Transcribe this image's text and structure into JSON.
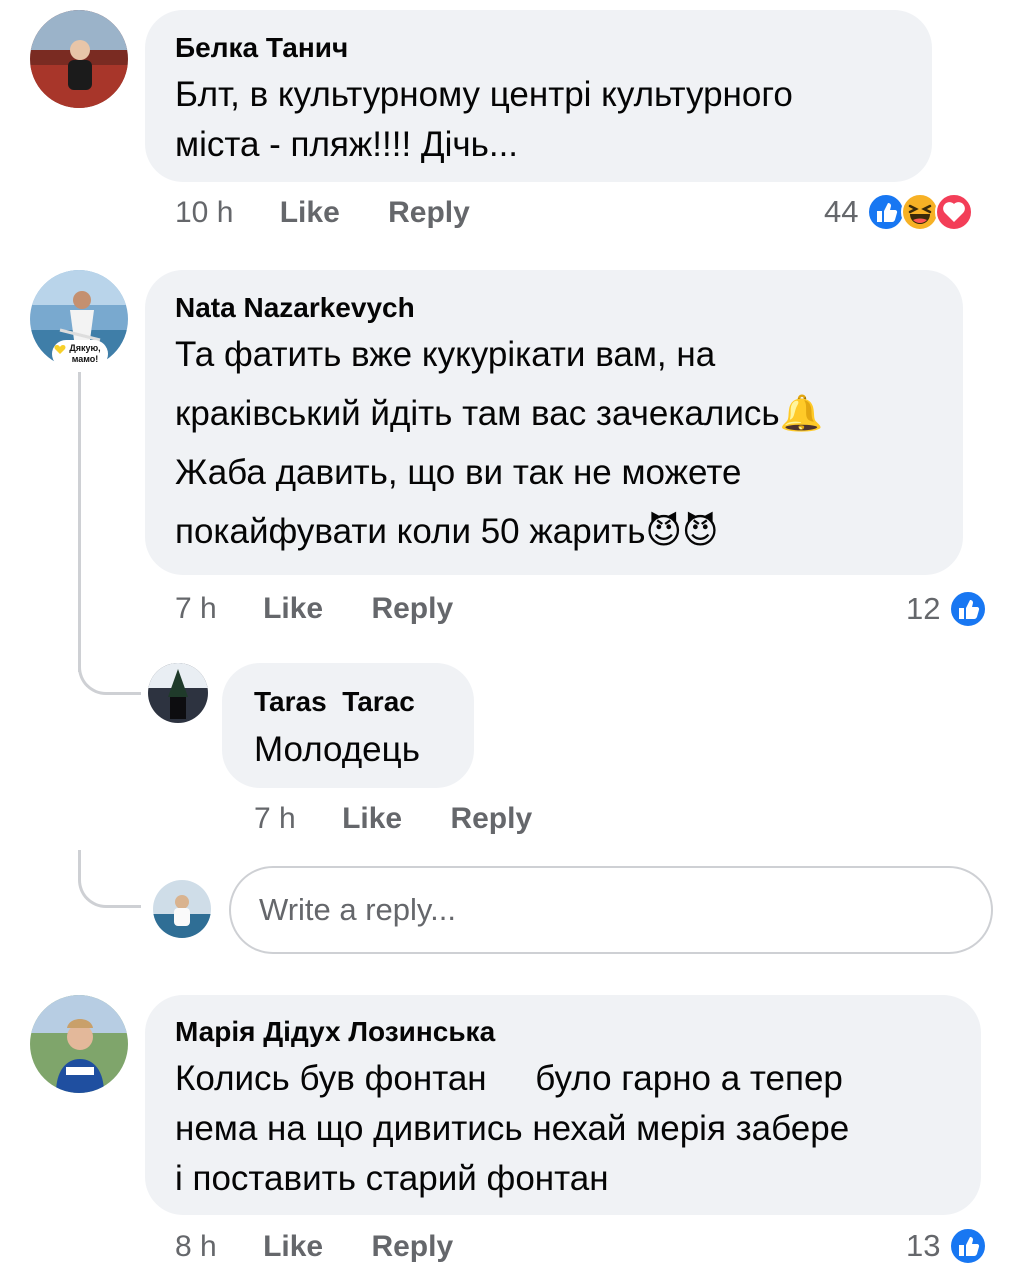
{
  "comments": [
    {
      "author": "Белка Танич",
      "lines": [
        "Блт, в культурному центрі культурного",
        "міста - пляж!!!! Дічь..."
      ],
      "time": "10 h",
      "like": "Like",
      "reply": "Reply",
      "reaction_count": "44",
      "reactions": [
        "like-icon",
        "haha-icon",
        "love-icon"
      ]
    },
    {
      "author": "Nata Nazarkevych",
      "avatar_badge": "Дякую, мамо!",
      "lines": [
        "Та фатить вже кукурікати вам, на",
        "краківський йдіть там вас зачекались🔔",
        "Жаба давить, що ви так не можете",
        "покайфувати коли 50 жарить😈😈"
      ],
      "time": "7 h",
      "like": "Like",
      "reply": "Reply",
      "reaction_count": "12",
      "reactions": [
        "like-icon"
      ],
      "replies": [
        {
          "author": "Taras  Tarac",
          "lines": [
            "Молодець"
          ],
          "time": "7 h",
          "like": "Like",
          "reply": "Reply"
        }
      ],
      "reply_input": {
        "placeholder": "Write a reply..."
      }
    },
    {
      "author": "Марія Дідух Лозинська",
      "lines": [
        "Колись був фонтан     було гарно а тепер",
        "нема на що дивитись нехай мерія забере",
        "і поставить старий фонтан"
      ],
      "time": "8 h",
      "like": "Like",
      "reply": "Reply",
      "reaction_count": "13",
      "reactions": [
        "like-icon"
      ]
    }
  ],
  "colors": {
    "bubble": "#f0f2f5",
    "meta_text": "#65676b",
    "like_blue": "#1877f2",
    "love_red": "#f33e58",
    "haha_yellow": "#f7b125"
  }
}
